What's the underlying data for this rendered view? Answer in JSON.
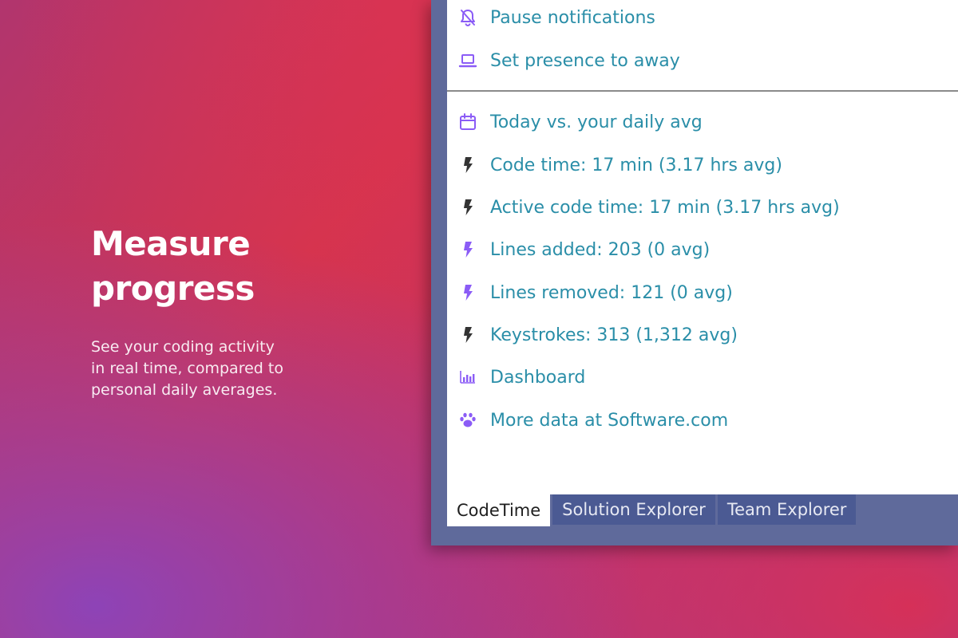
{
  "hero": {
    "title_line1": "Measure",
    "title_line2": "progress",
    "subtitle_line1": "See your coding activity",
    "subtitle_line2": "in real time, compared to",
    "subtitle_line3": "personal daily averages."
  },
  "menu": {
    "top_items": [
      {
        "label": "Pause notifications",
        "icon": "bell-off-icon"
      },
      {
        "label": "Set presence to away",
        "icon": "laptop-icon"
      }
    ],
    "stats_items": [
      {
        "label": "Today vs. your daily avg",
        "icon": "calendar-icon"
      },
      {
        "label": "Code time: 17 min (3.17 hrs avg)",
        "icon": "bolt-icon"
      },
      {
        "label": "Active code time: 17 min (3.17 hrs avg)",
        "icon": "bolt-icon"
      },
      {
        "label": "Lines added: 203 (0 avg)",
        "icon": "bolt-icon"
      },
      {
        "label": "Lines removed: 121 (0 avg)",
        "icon": "bolt-icon"
      },
      {
        "label": "Keystrokes: 313 (1,312 avg)",
        "icon": "bolt-icon"
      },
      {
        "label": "Dashboard",
        "icon": "bar-chart-icon"
      },
      {
        "label": "More data at Software.com",
        "icon": "paw-icon"
      }
    ]
  },
  "tabs": [
    {
      "label": "CodeTime",
      "active": true
    },
    {
      "label": "Solution Explorer",
      "active": false
    },
    {
      "label": "Team Explorer",
      "active": false
    }
  ],
  "colors": {
    "link_text": "#2a8ea8",
    "icon_purple": "#8b5cf6",
    "icon_dark": "#333333",
    "tab_inactive": "#4b5a93",
    "frame": "#5f6a9b"
  }
}
